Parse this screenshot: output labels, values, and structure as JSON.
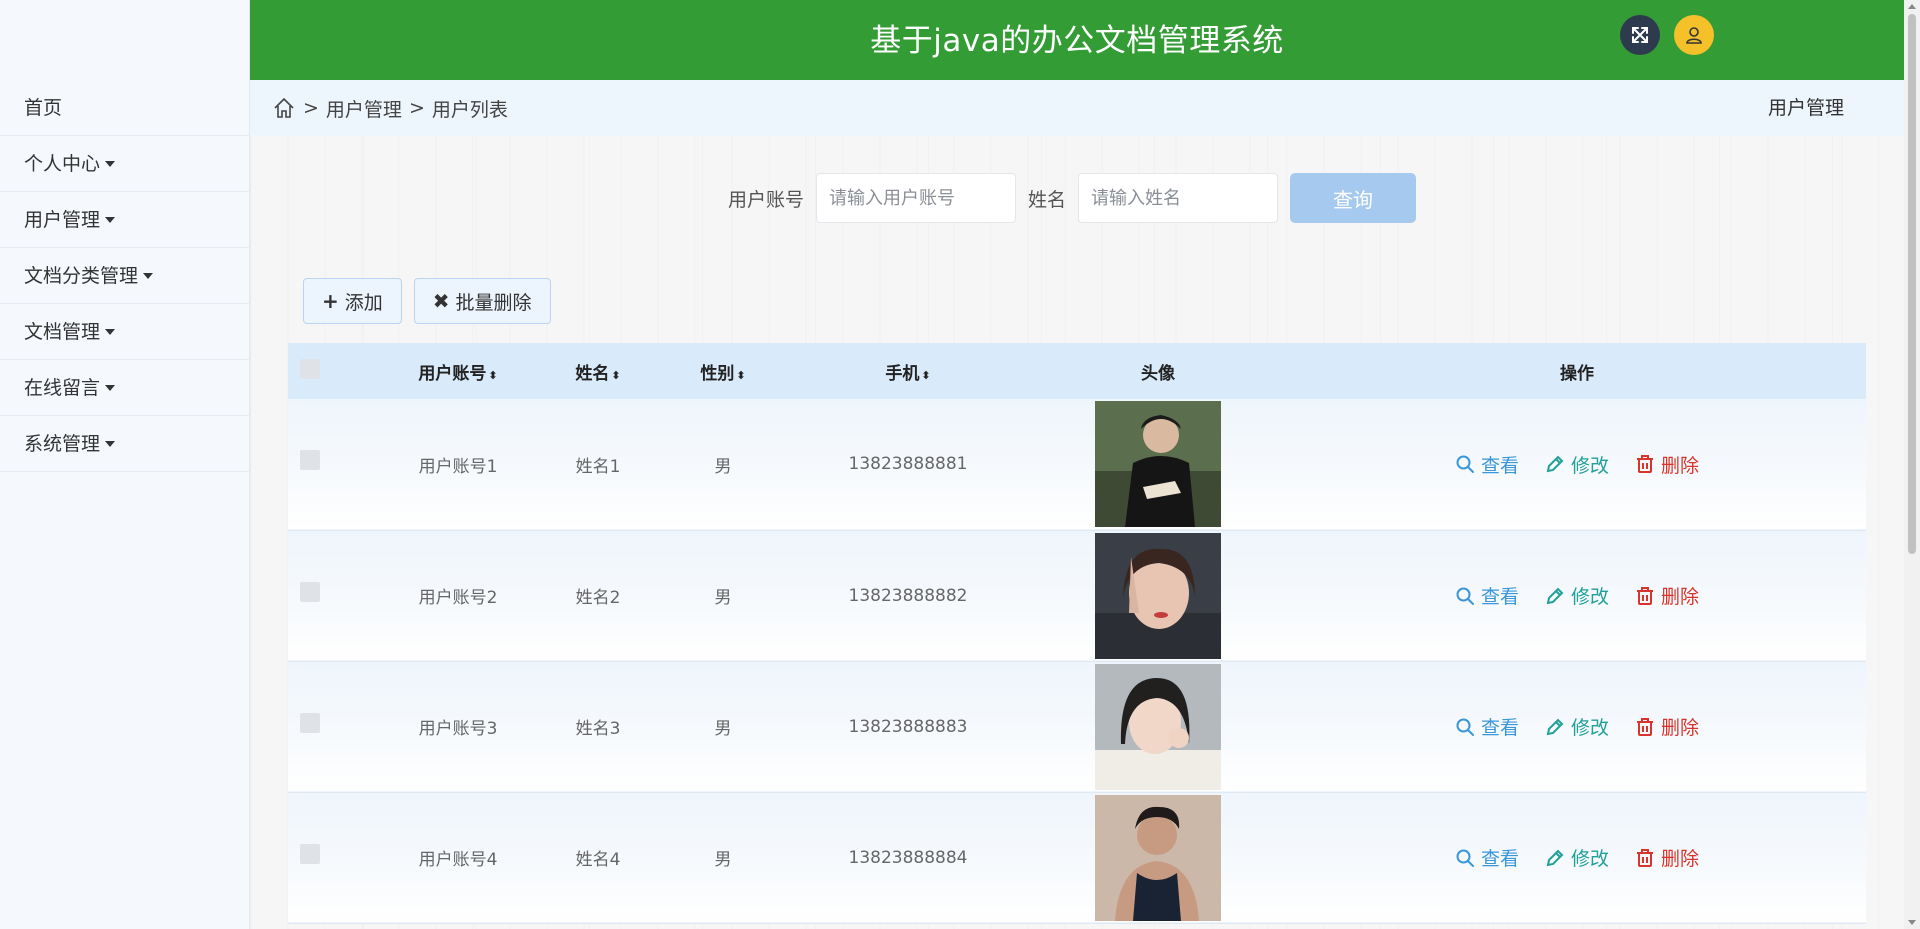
{
  "app": {
    "title": "基于java的办公文档管理系统"
  },
  "sidebar": {
    "items": [
      {
        "label": "首页",
        "has_caret": false
      },
      {
        "label": "个人中心",
        "has_caret": true
      },
      {
        "label": "用户管理",
        "has_caret": true
      },
      {
        "label": "文档分类管理",
        "has_caret": true
      },
      {
        "label": "文档管理",
        "has_caret": true
      },
      {
        "label": "在线留言",
        "has_caret": true
      },
      {
        "label": "系统管理",
        "has_caret": true
      }
    ]
  },
  "header": {
    "icons": [
      "fullscreen-icon",
      "user-icon"
    ],
    "bg_color": "#339c35"
  },
  "breadcrumb": {
    "home_icon": "home-icon",
    "separator": ">",
    "items": [
      "用户管理",
      "用户列表"
    ],
    "right_title": "用户管理"
  },
  "search": {
    "account_label": "用户账号",
    "account_placeholder": "请输入用户账号",
    "name_label": "姓名",
    "name_placeholder": "请输入姓名",
    "button_label": "查询"
  },
  "actions": {
    "add_label": "添加",
    "batch_delete_label": "批量删除"
  },
  "table": {
    "columns": [
      "用户账号",
      "姓名",
      "性别",
      "手机",
      "头像",
      "操作"
    ],
    "rows": [
      {
        "account": "用户账号1",
        "name": "姓名1",
        "gender": "男",
        "phone": "13823888881",
        "avatar": "avatar-1"
      },
      {
        "account": "用户账号2",
        "name": "姓名2",
        "gender": "男",
        "phone": "13823888882",
        "avatar": "avatar-2"
      },
      {
        "account": "用户账号3",
        "name": "姓名3",
        "gender": "男",
        "phone": "13823888883",
        "avatar": "avatar-3"
      },
      {
        "account": "用户账号4",
        "name": "姓名4",
        "gender": "男",
        "phone": "13823888884",
        "avatar": "avatar-4"
      }
    ],
    "ops": {
      "view_label": "查看",
      "edit_label": "修改",
      "delete_label": "删除"
    }
  },
  "colors": {
    "primary_green": "#339c35",
    "view": "#3a97d9",
    "edit": "#21a099",
    "delete": "#d9342b",
    "search_button": "#a6c9ef"
  }
}
